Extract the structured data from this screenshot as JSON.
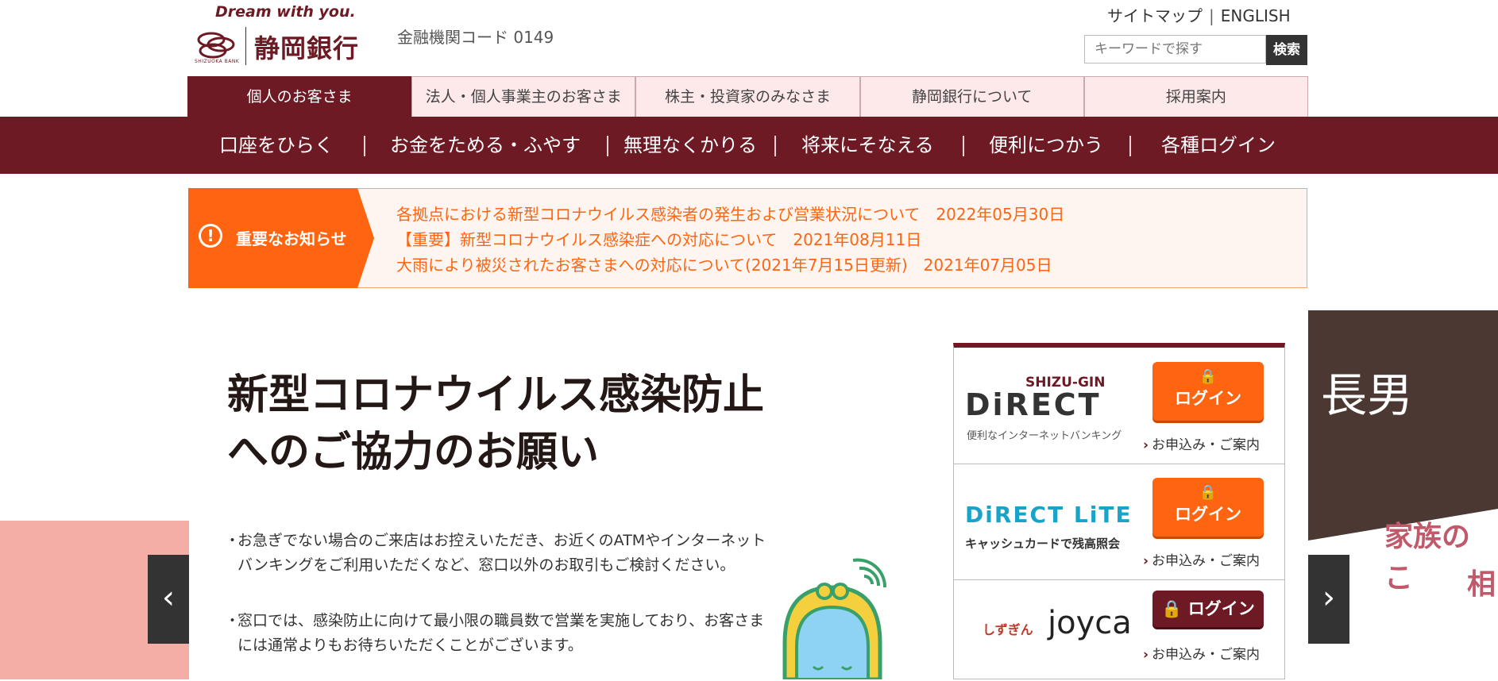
{
  "header": {
    "tagline": "Dream with you.",
    "bank_name": "静岡銀行",
    "bank_name_en": "SHIZUOKA BANK",
    "institution_code": "金融機関コード 0149",
    "sitemap": "サイトマップ",
    "separator": "|",
    "english": "ENGLISH",
    "search_placeholder": "キーワードで探す",
    "search_button": "検索"
  },
  "tabs": [
    {
      "label": "個人のお客さま",
      "active": true
    },
    {
      "label": "法人・個人事業主のお客さま",
      "active": false
    },
    {
      "label": "株主・投資家のみなさま",
      "active": false
    },
    {
      "label": "静岡銀行について",
      "active": false
    },
    {
      "label": "採用案内",
      "active": false
    }
  ],
  "nav": [
    "口座をひらく",
    "お金をためる・ふやす",
    "無理なくかりる",
    "将来にそなえる",
    "便利につかう",
    "各種ログイン"
  ],
  "notice": {
    "title": "重要なお知らせ",
    "icon": "!",
    "items": [
      "各拠点における新型コロナウイルス感染者の発生および営業状況について　2022年05月30日",
      "【重要】新型コロナウイルス感染症への対応について　2021年08月11日",
      "大雨により被災されたお客さまへの対応について(2021年7月15日更新)　2021年07月05日"
    ]
  },
  "hero": {
    "title_line1": "新型コロナウイルス感染防止",
    "title_line2": "へのご協力のお願い",
    "bullet_mark": "・",
    "bullets": [
      "お急ぎでない場合のご来店はお控えいただき、お近くのATMやインターネットバンキングをご利用いただくなど、窓口以外のお取引もご検討ください。",
      "窓口では、感染防止に向けて最小限の職員数で営業を実施しており、お客さまには通常よりもお待ちいただくことがございます。"
    ],
    "prev_arrow": "‹",
    "next_arrow": "›"
  },
  "login_panel": [
    {
      "brand_top": "SHIZU-GIN",
      "brand": "DiRECT",
      "brand_sub": "便利なインターネットバンキング",
      "login": "ログイン",
      "apply": "お申込み・ご案内"
    },
    {
      "brand": "DiRECT LiTE",
      "brand_sub": "キャッシュカードで残高照会",
      "login": "ログイン",
      "apply": "お申込み・ご案内"
    },
    {
      "brand_small": "しずぎん",
      "brand": "joyca",
      "login": "ログイン",
      "apply": "お申込み・ご案内"
    }
  ],
  "side_banner": {
    "title": "長男",
    "text1": "家族のこ",
    "text2": "相"
  },
  "colors": {
    "brand": "#6d1a24",
    "notice": "#ff6410",
    "tab_bg": "#fde8ea"
  }
}
